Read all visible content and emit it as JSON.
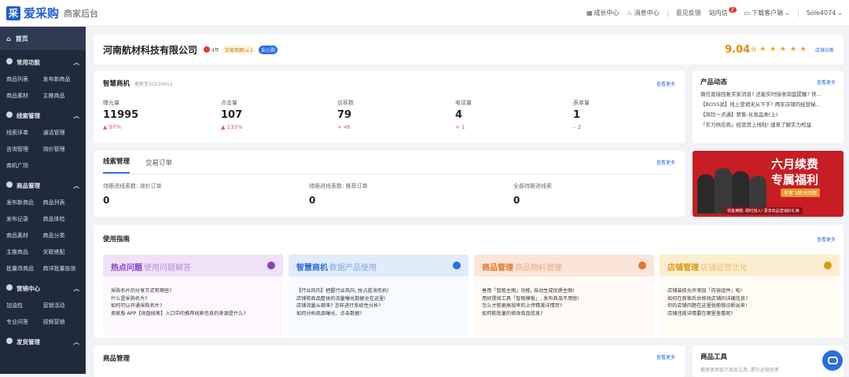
{
  "header": {
    "logo_mark": "采",
    "logo_text": "爱采购",
    "logo_sub": "商家后台",
    "links": [
      "成长中心",
      "消息中心",
      "意见反馈",
      "站内信",
      "下载客户端",
      "Sole4074"
    ],
    "mail_badge": "2"
  },
  "sidebar": {
    "home": "首页",
    "sections": [
      {
        "title": "常用功能",
        "items": [
          "商品列表",
          "发布新商品",
          "商品素材",
          "主推商品"
        ]
      },
      {
        "title": "线索管理",
        "items": [
          "线索详单",
          "通话管理",
          "咨询管理",
          "询价管理",
          "商机广场"
        ]
      },
      {
        "title": "商品管理",
        "items": [
          "发布新商品",
          "商品列表",
          "发布记录",
          "商品体检",
          "商品素材",
          "商品分类",
          "主推商品",
          "关联搭配",
          "批量改商品",
          "商详批量投放"
        ]
      },
      {
        "title": "营销中心",
        "items": [
          "加油包",
          "营销活动",
          "专业问答",
          "视频营销"
        ]
      },
      {
        "title": "发货管理",
        "items": []
      }
    ]
  },
  "company": {
    "name": "河南航材科技有限公司",
    "years": "4年",
    "level": "交易观察Lv.1",
    "tag": "安心购",
    "score": "9.04",
    "score_unit": "分",
    "stars": "★ ★ ★ ★ ★",
    "diagnose": "店铺诊断"
  },
  "smart": {
    "title": "智慧商机",
    "updated": "更新至20230612",
    "more": "查看更多",
    "metrics": [
      {
        "label": "曝光量",
        "value": "11995",
        "change": "97%",
        "dir": "up"
      },
      {
        "label": "点击量",
        "value": "107",
        "change": "133%",
        "dir": "up"
      },
      {
        "label": "访客数",
        "value": "79",
        "change": "46",
        "dir": "up"
      },
      {
        "label": "电话量",
        "value": "4",
        "change": "1",
        "dir": "up"
      },
      {
        "label": "表单量",
        "value": "1",
        "change": "2",
        "dir": "eq"
      }
    ]
  },
  "news": {
    "title": "产品动态",
    "more": "查看更多",
    "items": [
      "微信直接回复买家消息? 还能实时接收询盘提醒? 快...",
      "【BOSS说】线上营销无从下手? 两年店铺的经营秘...",
      "【风险一点通】禁售-化妆品类(上)",
      "「实力供应商」经营页上线啦! 速来了解实力权益"
    ]
  },
  "leads": {
    "tabs": [
      "线索管理",
      "交易订单"
    ],
    "more": "查看更多",
    "stats": [
      {
        "label": "待跟进线索数: 询价订单",
        "value": "0"
      },
      {
        "label": "待跟进线索数: 推荐订单",
        "value": "0"
      },
      {
        "label": "全部待跟进线索",
        "value": "0"
      }
    ]
  },
  "banner": {
    "line1": "六月续费",
    "line2": "专属福利",
    "line3": "老客飞跃大回馈",
    "line4": "现金满赠, 即时加入! 更享商品营销好礼等"
  },
  "guide": {
    "title": "使用指南",
    "more": "查看更多",
    "boxes": [
      {
        "title": "热点问题",
        "sub": "使用问题解答",
        "color": "#8a3fc7",
        "bg": "#efe2f8",
        "items": [
          "采购名片的分享方式有哪些?",
          "什么是采购名片?",
          "如何可以开通采购名片?",
          "卖家版 APP【询盘线索】入口中的推荐线索信息的来源是什么?"
        ]
      },
      {
        "title": "智慧商机",
        "sub": "数据产品使用",
        "color": "#2b6de0",
        "bg": "#e1ecfb",
        "items": [
          "【行业风向】把握行业风向, 抢占蓝海先机!",
          "店铺和商品整体的流量曝光数据全在这里!",
          "店铺流量从哪来? 怎样进行系统性分析?",
          "如何分析商品曝光、点击数据?"
        ]
      },
      {
        "title": "商品管理",
        "sub": "商品物料管理",
        "color": "#e2772a",
        "bg": "#fbe5d9",
        "items": [
          "善用「智能主图」功能, 自动生成优质主图!",
          "用好提效工具「智能模板」, 发布商品不用愁!",
          "怎么才能更高效率的上传精美详情页?",
          "如何能批量的修改商品信息?"
        ]
      },
      {
        "title": "店铺管理",
        "sub": "店铺运营优化",
        "color": "#d89a12",
        "bg": "#fbeed0",
        "items": [
          "店铺装修允许添加「内容组件」啦!",
          "如何在商家后台修改店铺的详细信息?",
          "你的店铺问题在这里就能够诊断出来!",
          "店铺违规详情要在哪里查看呢?"
        ]
      }
    ]
  },
  "goods": {
    "title": "商品管理",
    "more": "查看更多"
  },
  "tools": {
    "title": "商品工具",
    "sub": "推荐使用如下商品工具, 提升运营效率"
  }
}
